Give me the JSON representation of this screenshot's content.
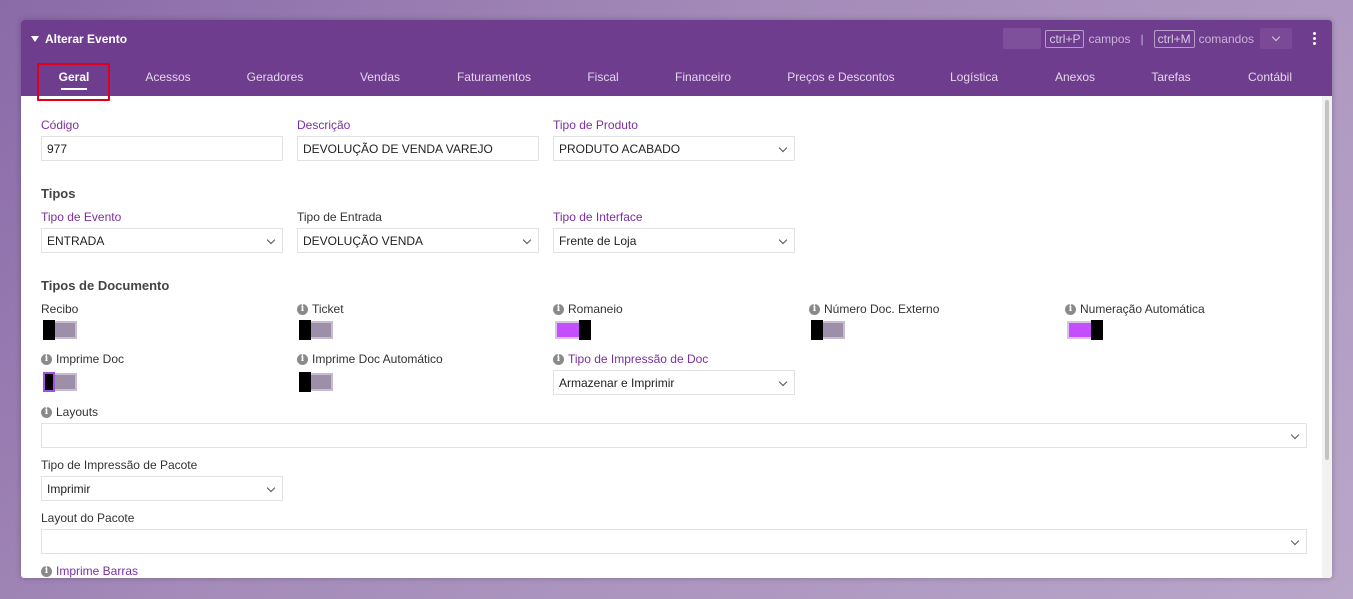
{
  "window": {
    "title": "Alterar Evento",
    "shortcut_fields_key": "ctrl+P",
    "shortcut_fields_label": "campos",
    "separator": "|",
    "shortcut_commands_key": "ctrl+M",
    "shortcut_commands_label": "comandos"
  },
  "tabs": [
    {
      "label": "Geral",
      "active": true
    },
    {
      "label": "Acessos"
    },
    {
      "label": "Geradores"
    },
    {
      "label": "Vendas"
    },
    {
      "label": "Faturamentos"
    },
    {
      "label": "Fiscal"
    },
    {
      "label": "Financeiro"
    },
    {
      "label": "Preços e Descontos"
    },
    {
      "label": "Logística"
    },
    {
      "label": "Anexos"
    },
    {
      "label": "Tarefas"
    },
    {
      "label": "Contábil"
    }
  ],
  "general": {
    "codigo_label": "Código",
    "codigo_value": "977",
    "descricao_label": "Descrição",
    "descricao_value": "DEVOLUÇÃO DE VENDA VAREJO",
    "tipo_produto_label": "Tipo de Produto",
    "tipo_produto_value": "PRODUTO ACABADO"
  },
  "tipos": {
    "section_title": "Tipos",
    "tipo_evento_label": "Tipo de Evento",
    "tipo_evento_value": "ENTRADA",
    "tipo_entrada_label": "Tipo de Entrada",
    "tipo_entrada_value": "DEVOLUÇÃO VENDA",
    "tipo_interface_label": "Tipo de Interface",
    "tipo_interface_value": "Frente de Loja"
  },
  "documento": {
    "section_title": "Tipos de Documento",
    "recibo_label": "Recibo",
    "recibo_on": false,
    "ticket_label": "Ticket",
    "ticket_on": false,
    "romaneio_label": "Romaneio",
    "romaneio_on": true,
    "num_doc_externo_label": "Número Doc. Externo",
    "num_doc_externo_on": false,
    "numeracao_auto_label": "Numeração Automática",
    "numeracao_auto_on": true,
    "imprime_doc_label": "Imprime Doc",
    "imprime_doc_on": false,
    "imprime_doc_auto_label": "Imprime Doc Automático",
    "imprime_doc_auto_on": false,
    "tipo_impressao_doc_label": "Tipo de Impressão de Doc",
    "tipo_impressao_doc_value": "Armazenar e Imprimir",
    "layouts_label": "Layouts",
    "layouts_value": "",
    "tipo_impressao_pacote_label": "Tipo de Impressão de Pacote",
    "tipo_impressao_pacote_value": "Imprimir",
    "layout_pacote_label": "Layout do Pacote",
    "layout_pacote_value": "",
    "imprime_barras_label": "Imprime Barras"
  },
  "colors": {
    "header": "#6f3d8e",
    "accent": "#7b2fa0",
    "toggle_on": "#c44fff",
    "highlight": "#e0001b"
  }
}
